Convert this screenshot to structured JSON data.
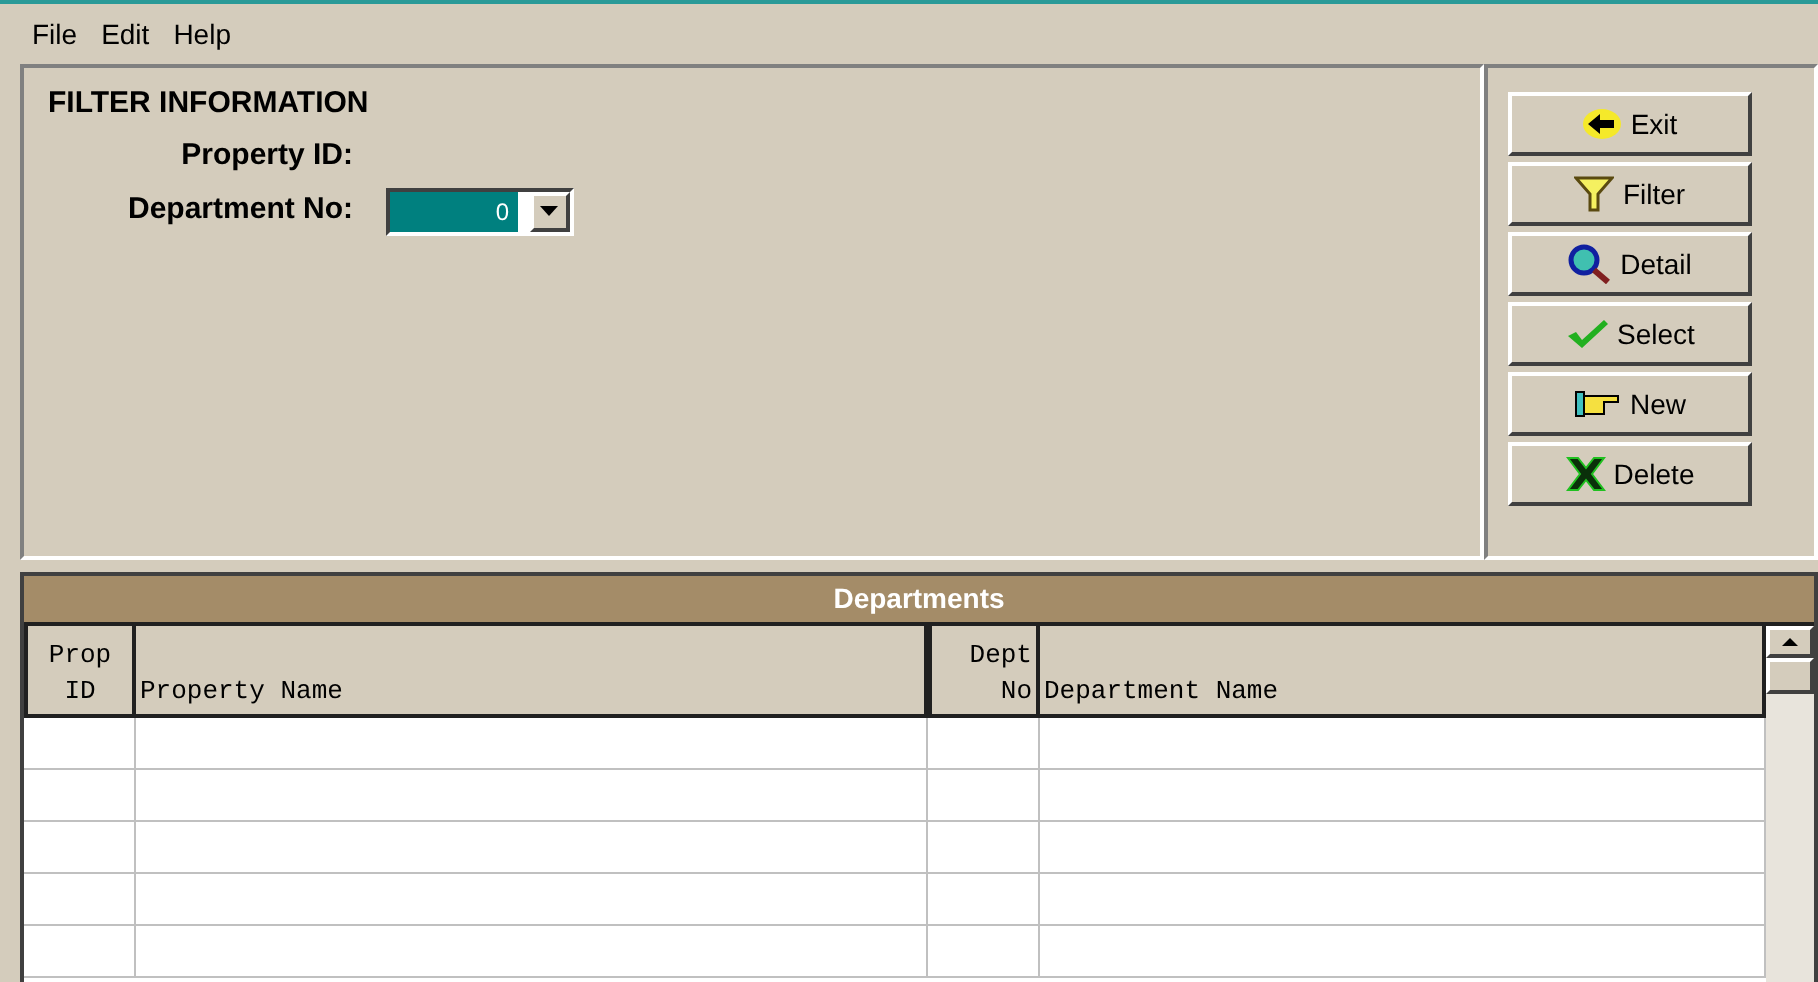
{
  "menu": [
    "File",
    "Edit",
    "Help"
  ],
  "filter": {
    "title": "FILTER INFORMATION",
    "fields": [
      {
        "label": "Property ID:",
        "kind": "text"
      },
      {
        "label": "Department No:",
        "kind": "dropdown",
        "value": "0",
        "selected": true
      }
    ]
  },
  "buttons": [
    {
      "label": "Exit",
      "kind": "exit"
    },
    {
      "label": "Filter",
      "kind": "filter"
    },
    {
      "label": "Detail",
      "kind": "detail"
    },
    {
      "label": "Select",
      "kind": "select"
    },
    {
      "label": "New",
      "kind": "new"
    },
    {
      "label": "Delete",
      "kind": "delete"
    }
  ],
  "table": {
    "title": "Departments",
    "columns": [
      {
        "lines": [
          "Prop",
          "ID"
        ],
        "kind": "id"
      },
      {
        "lines": [
          "Property Name"
        ],
        "kind": "text"
      },
      {
        "lines": [
          "Dept",
          "No"
        ],
        "kind": "number"
      },
      {
        "lines": [
          "Department Name"
        ],
        "kind": "text"
      }
    ]
  }
}
